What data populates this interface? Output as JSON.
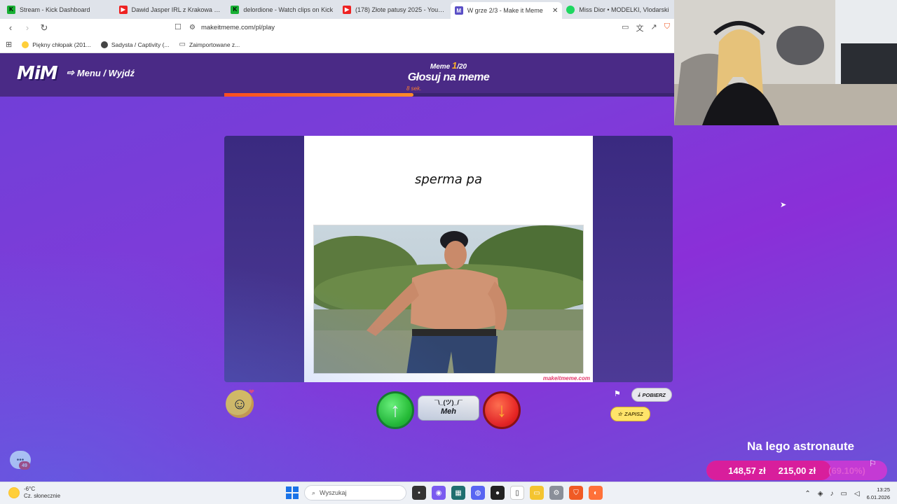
{
  "browser": {
    "tabs": [
      {
        "title": "Stream - Kick Dashboard",
        "fav": "kick",
        "favtext": "K",
        "active": false
      },
      {
        "title": "Dawid Jasper IRL z Krakowa - Spotkanie",
        "fav": "yt",
        "favtext": "▶",
        "active": false
      },
      {
        "title": "delordione - Watch clips on Kick",
        "fav": "kick",
        "favtext": "K",
        "active": false
      },
      {
        "title": "(178) Złote patusy 2025 - YouTube",
        "fav": "yt",
        "favtext": "▶",
        "active": false
      },
      {
        "title": "W grze 2/3 - Make it Meme",
        "fav": "mim",
        "favtext": "M",
        "active": true
      },
      {
        "title": "Miss Dior • MODELKI, Vlodarski",
        "fav": "spot",
        "favtext": "",
        "active": false
      }
    ],
    "url": "makeitmeme.com/pl/play",
    "bookmarks": [
      "Piękny chłopak (201...",
      "Sadysta / Captivity (...",
      "Zaimportowane z..."
    ]
  },
  "game": {
    "logo": "MiM",
    "menu_exit": "Menu / Wyjdź",
    "meme_current": "1",
    "meme_total": "/20",
    "meme_prefix": "Meme ",
    "round_title": "Głosuj na meme",
    "timer": "8 sek.",
    "progress": 0.42,
    "meme_caption": "sperma pa",
    "watermark": "makeitmeme.com",
    "meh_shrug": "¯\\_(ツ)_/¯",
    "meh_label": "Meh",
    "download_label": "POBIERZ",
    "save_label": "ZAPISZ",
    "chat_badge": "49"
  },
  "goal": {
    "title": "Na lego astronaute",
    "current": "148,57 zł",
    "target": "215,00 zł",
    "percent_text": "(69.10%)",
    "fraction": 0.691
  },
  "taskbar": {
    "temp": "-6°C",
    "weather": "Cz. słonecznie",
    "search_placeholder": "Wyszukaj",
    "time": "13:25",
    "date": "6.01.2026"
  },
  "colors": {
    "accent_orange": "#ff4d1f",
    "vote_up": "#1fc21f",
    "vote_down": "#e52424",
    "goal_pink": "#d81e9c"
  }
}
